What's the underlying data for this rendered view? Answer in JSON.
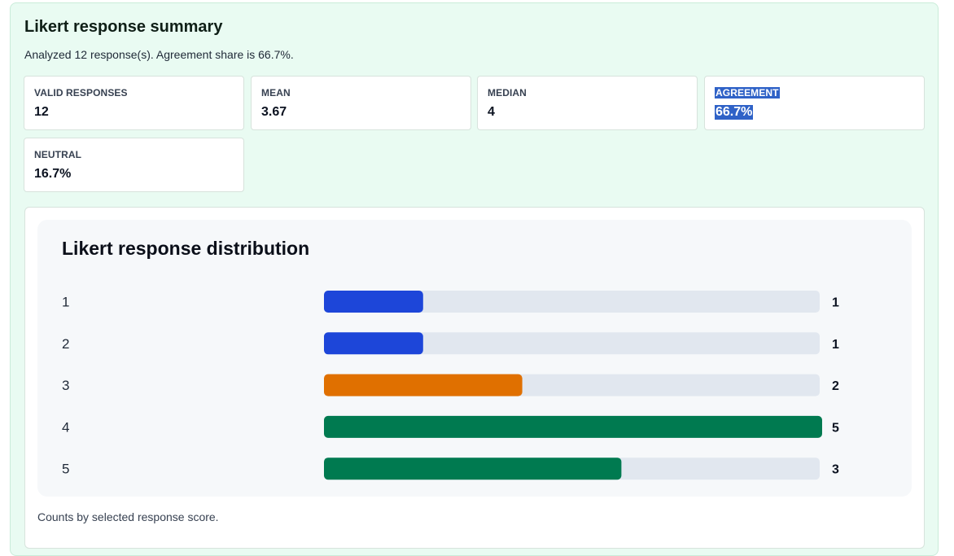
{
  "summary": {
    "title": "Likert response summary",
    "subtitle": "Analyzed 12 response(s). Agreement share is 66.7%.",
    "cards": [
      {
        "label": "VALID RESPONSES",
        "value": "12"
      },
      {
        "label": "MEAN",
        "value": "3.67"
      },
      {
        "label": "MEDIAN",
        "value": "4"
      },
      {
        "label": "AGREEMENT",
        "value": "66.7%"
      },
      {
        "label": "NEUTRAL",
        "value": "16.7%"
      }
    ]
  },
  "chart_data": {
    "type": "bar",
    "orientation": "horizontal",
    "title": "Likert response distribution",
    "categories": [
      "1",
      "2",
      "3",
      "4",
      "5"
    ],
    "values": [
      1,
      1,
      2,
      5,
      3
    ],
    "xlim": [
      0,
      5
    ],
    "colors": [
      "#1d46d9",
      "#1d46d9",
      "#e07000",
      "#007a50",
      "#007a50"
    ],
    "track_color": "#e1e7ef",
    "grid": false
  },
  "caption": "Counts by selected response score."
}
